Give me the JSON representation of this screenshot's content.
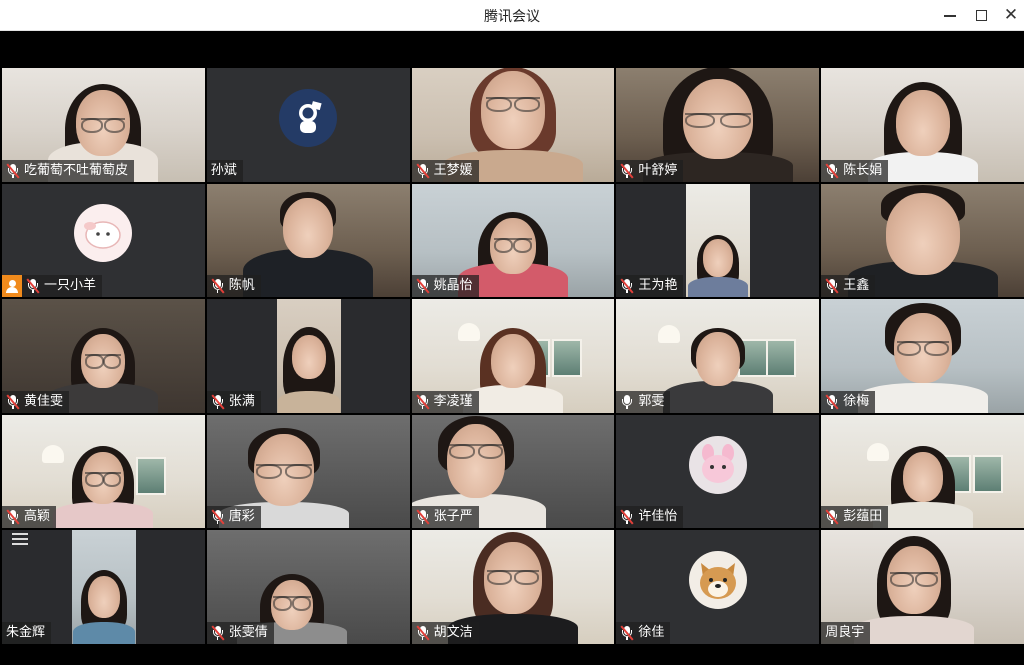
{
  "window": {
    "title": "腾讯会议"
  },
  "participants": [
    {
      "name": "吃葡萄不吐葡萄皮",
      "muted": true
    },
    {
      "name": "孙斌",
      "muted": false,
      "avatar": "astronaut-avatar"
    },
    {
      "name": "王梦媛",
      "muted": true
    },
    {
      "name": "叶舒婷",
      "muted": true
    },
    {
      "name": "陈长娟",
      "muted": true
    },
    {
      "name": "一只小羊",
      "muted": true,
      "avatar": "sheep-avatar",
      "host": true
    },
    {
      "name": "陈帆",
      "muted": true
    },
    {
      "name": "姚晶怡",
      "muted": true
    },
    {
      "name": "王为艳",
      "muted": true
    },
    {
      "name": "王鑫",
      "muted": true
    },
    {
      "name": "黄佳雯",
      "muted": true
    },
    {
      "name": "张满",
      "muted": true
    },
    {
      "name": "李凌瑾",
      "muted": true
    },
    {
      "name": "郭雯",
      "muted": false
    },
    {
      "name": "徐梅",
      "muted": true
    },
    {
      "name": "高颖",
      "muted": true
    },
    {
      "name": "唐彩",
      "muted": true
    },
    {
      "name": "张子严",
      "muted": true
    },
    {
      "name": "许佳怡",
      "muted": true,
      "avatar": "pink-toy-avatar"
    },
    {
      "name": "彭蕴田",
      "muted": true
    },
    {
      "name": "朱金辉",
      "muted": false
    },
    {
      "name": "张雯倩",
      "muted": true
    },
    {
      "name": "胡文洁",
      "muted": true
    },
    {
      "name": "徐佳",
      "muted": true,
      "avatar": "shiba-dog-avatar"
    },
    {
      "name": "周良宇",
      "muted": false
    }
  ],
  "colors": {
    "muted_slash": "#e3403a",
    "host_badge": "#f08a1c",
    "label_bg": "rgba(30,30,30,0.72)"
  }
}
